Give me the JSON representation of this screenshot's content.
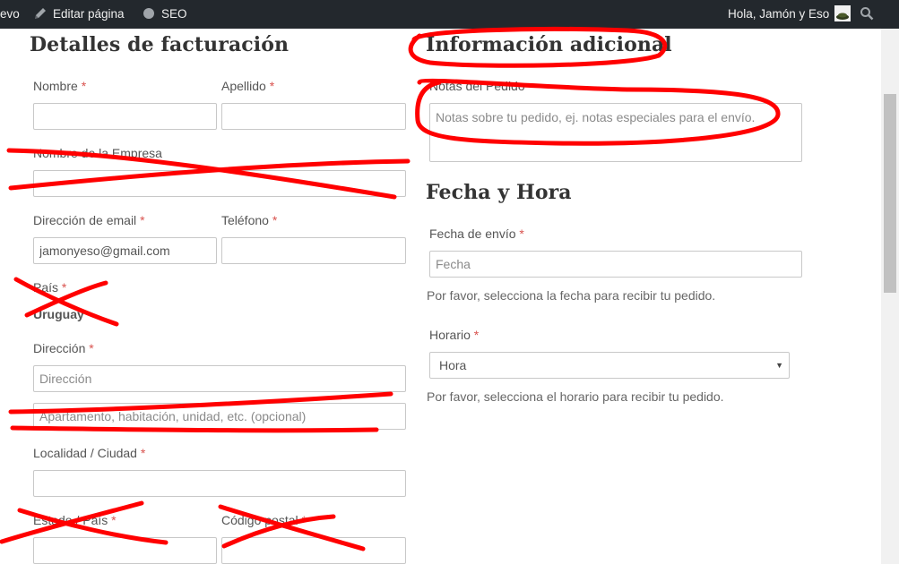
{
  "admin_bar": {
    "new_label": "evo",
    "edit_label": "Editar página",
    "seo_label": "SEO",
    "greeting": "Hola, Jamón y Eso",
    "icons": [
      "pencil-icon",
      "circle-icon",
      "avatar-icon",
      "search-icon"
    ]
  },
  "billing": {
    "heading": "Detalles de facturación",
    "first_name_label": "Nombre",
    "last_name_label": "Apellido",
    "company_label": "Nombre de la Empresa",
    "email_label": "Dirección de email",
    "email_value": "jamonyeso@gmail.com",
    "phone_label": "Teléfono",
    "country_label": "País",
    "country_value": "Uruguay",
    "address_label": "Dirección",
    "address_placeholder": "Dirección",
    "address2_placeholder": "Apartamento, habitación, unidad, etc. (opcional)",
    "city_label": "Localidad / Ciudad",
    "state_label": "Estado / País",
    "postcode_label": "Código postal",
    "required_mark": "*"
  },
  "additional": {
    "heading": "Información adicional",
    "notes_label": "Notas del Pedido",
    "notes_placeholder": "Notas sobre tu pedido, ej. notas especiales para el envío."
  },
  "delivery": {
    "heading": "Fecha y Hora",
    "date_label": "Fecha de envío",
    "date_placeholder": "Fecha",
    "date_help": "Por favor, selecciona la fecha para recibir tu pedido.",
    "time_label": "Horario",
    "time_selected": "Hora",
    "time_help": "Por favor, selecciona el horario para recibir tu pedido."
  },
  "colors": {
    "admin_bar": "#23282d",
    "required": "#d9534f",
    "annotation": "#ff0000"
  }
}
